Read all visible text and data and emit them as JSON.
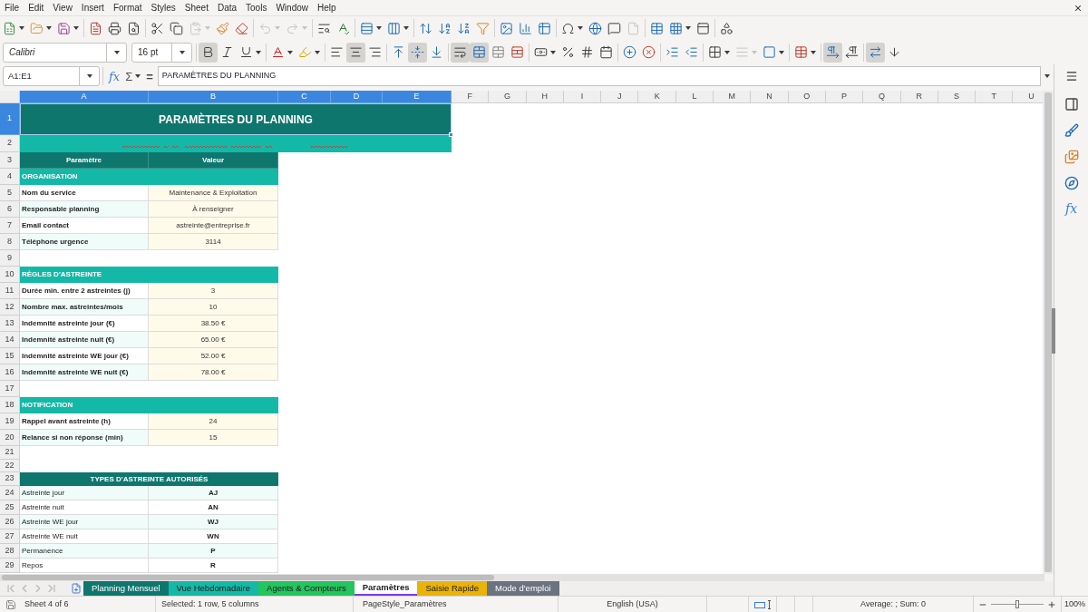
{
  "menu_bar": {
    "items": [
      "File",
      "Edit",
      "View",
      "Insert",
      "Format",
      "Styles",
      "Sheet",
      "Data",
      "Tools",
      "Window",
      "Help"
    ]
  },
  "standard_toolbar": [
    [
      {
        "kind": "new",
        "disabled": false
      },
      {
        "kind": "open",
        "disabled": false
      },
      {
        "kind": "save",
        "disabled": false
      }
    ],
    [
      {
        "kind": "export_pdf",
        "disabled": false
      },
      {
        "kind": "print",
        "disabled": false
      },
      {
        "kind": "print_preview",
        "disabled": false
      }
    ],
    [
      {
        "kind": "cut",
        "disabled": false
      },
      {
        "kind": "copy",
        "disabled": false
      },
      {
        "kind": "paste",
        "disabled": true
      },
      {
        "kind": "clone_formatting",
        "disabled": false
      },
      {
        "kind": "clear_formatting",
        "disabled": false
      }
    ],
    [
      {
        "kind": "undo",
        "disabled": true
      },
      {
        "kind": "redo",
        "disabled": true
      }
    ],
    [
      {
        "kind": "find_replace",
        "disabled": false
      },
      {
        "kind": "spelling",
        "disabled": false
      }
    ],
    [
      {
        "kind": "rows",
        "disabled": false
      },
      {
        "kind": "columns",
        "disabled": false
      }
    ],
    [
      {
        "kind": "sort",
        "disabled": false
      },
      {
        "kind": "sort_ascending",
        "disabled": false
      },
      {
        "kind": "sort_descending",
        "disabled": false
      },
      {
        "kind": "autofilter",
        "disabled": false
      }
    ],
    [
      {
        "kind": "image",
        "disabled": false
      },
      {
        "kind": "chart",
        "disabled": false
      },
      {
        "kind": "pivot_table",
        "disabled": false
      }
    ],
    [
      {
        "kind": "special_character",
        "disabled": false
      },
      {
        "kind": "hyperlink",
        "disabled": false
      },
      {
        "kind": "comment",
        "disabled": false
      },
      {
        "kind": "headers_footers",
        "disabled": true
      }
    ],
    [
      {
        "kind": "print_area",
        "disabled": false
      },
      {
        "kind": "freeze",
        "disabled": false
      },
      {
        "kind": "split_window",
        "disabled": false
      }
    ],
    [
      {
        "kind": "draw_functions",
        "disabled": false
      }
    ]
  ],
  "formatting_toolbar": {
    "font_name": "Calibri",
    "font_size": "16 pt",
    "groups": [
      [
        {
          "kind": "bold",
          "disabled": false,
          "on": true
        },
        {
          "kind": "italic",
          "disabled": false,
          "on": false
        },
        {
          "kind": "underline",
          "disabled": false,
          "on": false
        }
      ],
      [
        {
          "kind": "font_color",
          "disabled": false,
          "on": false
        },
        {
          "kind": "highlight",
          "disabled": false,
          "on": false
        }
      ],
      [
        {
          "kind": "align_left",
          "disabled": false,
          "on": false
        },
        {
          "kind": "align_center",
          "disabled": false,
          "on": true
        },
        {
          "kind": "align_right",
          "disabled": false,
          "on": false
        }
      ],
      [
        {
          "kind": "align_top",
          "disabled": false,
          "on": false
        },
        {
          "kind": "align_middle",
          "disabled": false,
          "on": true
        },
        {
          "kind": "align_bottom",
          "disabled": false,
          "on": false
        }
      ],
      [
        {
          "kind": "wrap_text",
          "disabled": false,
          "on": true
        },
        {
          "kind": "merge_center",
          "disabled": false,
          "on": true
        },
        {
          "kind": "merge",
          "disabled": false,
          "on": false
        },
        {
          "kind": "unmerge",
          "disabled": false,
          "on": false
        }
      ],
      [
        {
          "kind": "currency",
          "disabled": false,
          "on": false
        },
        {
          "kind": "percent",
          "disabled": false,
          "on": false
        },
        {
          "kind": "number",
          "disabled": false,
          "on": false
        },
        {
          "kind": "date",
          "disabled": false,
          "on": false
        }
      ],
      [
        {
          "kind": "add_decimal",
          "disabled": false,
          "on": false
        },
        {
          "kind": "delete_decimal",
          "disabled": false,
          "on": false
        }
      ],
      [
        {
          "kind": "indent_increase",
          "disabled": false,
          "on": false
        },
        {
          "kind": "indent_decrease",
          "disabled": false,
          "on": false
        }
      ],
      [
        {
          "kind": "borders",
          "disabled": false,
          "on": false
        },
        {
          "kind": "border_style",
          "disabled": true,
          "on": false
        },
        {
          "kind": "border_color",
          "disabled": false,
          "on": false
        }
      ],
      [
        {
          "kind": "conditional",
          "disabled": false,
          "on": false
        }
      ],
      [
        {
          "kind": "left_to_right",
          "disabled": false,
          "on": true
        },
        {
          "kind": "right_to_left",
          "disabled": false,
          "on": false
        }
      ],
      [
        {
          "kind": "text_horizontal",
          "disabled": false,
          "on": true
        },
        {
          "kind": "text_vertical",
          "disabled": false,
          "on": false
        }
      ]
    ]
  },
  "formula_bar": {
    "name_box": "A1:E1",
    "wizard_symbol": "fx",
    "sum_symbol": "Σ",
    "equals_symbol": "=",
    "content": "PARAMÈTRES DU PLANNING"
  },
  "sidebar": {
    "functions_symbol": "fx"
  },
  "sheet": {
    "columns": [
      {
        "label": "A",
        "selected": true
      },
      {
        "label": "B",
        "selected": true
      },
      {
        "label": "C",
        "selected": true
      },
      {
        "label": "D",
        "selected": true
      },
      {
        "label": "E",
        "selected": true
      },
      {
        "label": "F",
        "selected": false
      },
      {
        "label": "G",
        "selected": false
      },
      {
        "label": "H",
        "selected": false
      },
      {
        "label": "I",
        "selected": false
      },
      {
        "label": "J",
        "selected": false
      },
      {
        "label": "K",
        "selected": false
      },
      {
        "label": "L",
        "selected": false
      },
      {
        "label": "M",
        "selected": false
      },
      {
        "label": "N",
        "selected": false
      },
      {
        "label": "O",
        "selected": false
      },
      {
        "label": "P",
        "selected": false
      },
      {
        "label": "Q",
        "selected": false
      },
      {
        "label": "R",
        "selected": false
      },
      {
        "label": "S",
        "selected": false
      },
      {
        "label": "T",
        "selected": false
      },
      {
        "label": "U",
        "selected": false
      }
    ],
    "rows": [
      {
        "number": "1",
        "selected": true,
        "kind": "title",
        "cells": [
          "PARAMÈTRES DU PLANNING"
        ]
      },
      {
        "number": "2",
        "selected": false,
        "kind": "subtitle"
      },
      {
        "number": "3",
        "selected": false,
        "kind": "table_header",
        "cells": [
          "Paramètre",
          "Valeur"
        ]
      },
      {
        "number": "4",
        "selected": false,
        "kind": "section",
        "cells": [
          "ORGANISATION"
        ]
      },
      {
        "number": "5",
        "selected": false,
        "kind": "param",
        "shaded": false,
        "cells": [
          "Nom du service",
          "Maintenance & Exploitation"
        ]
      },
      {
        "number": "6",
        "selected": false,
        "kind": "param",
        "shaded": true,
        "cells": [
          "Responsable planning",
          "À renseigner"
        ]
      },
      {
        "number": "7",
        "selected": false,
        "kind": "param",
        "shaded": false,
        "cells": [
          "Email contact",
          "astreinte@entreprise.fr"
        ]
      },
      {
        "number": "8",
        "selected": false,
        "kind": "param",
        "shaded": true,
        "cells": [
          "Téléphone urgence",
          "3114"
        ]
      },
      {
        "number": "9",
        "selected": false,
        "kind": "empty"
      },
      {
        "number": "10",
        "selected": false,
        "kind": "section",
        "cells": [
          "RÈGLES D'ASTREINTE"
        ]
      },
      {
        "number": "11",
        "selected": false,
        "kind": "param",
        "shaded": false,
        "cells": [
          "Durée min. entre 2 astreintes (j)",
          "3"
        ]
      },
      {
        "number": "12",
        "selected": false,
        "kind": "param",
        "shaded": true,
        "cells": [
          "Nombre max. astreintes/mois",
          "10"
        ]
      },
      {
        "number": "13",
        "selected": false,
        "kind": "param",
        "shaded": false,
        "cells": [
          "Indemnité astreinte jour (€)",
          "38.50 €"
        ]
      },
      {
        "number": "14",
        "selected": false,
        "kind": "param",
        "shaded": true,
        "cells": [
          "Indemnité astreinte nuit (€)",
          "65.00 €"
        ]
      },
      {
        "number": "15",
        "selected": false,
        "kind": "param",
        "shaded": false,
        "cells": [
          "Indemnité astreinte WE jour (€)",
          "52.00 €"
        ]
      },
      {
        "number": "16",
        "selected": false,
        "kind": "param",
        "shaded": true,
        "cells": [
          "Indemnité astreinte WE nuit (€)",
          "78.00 €"
        ]
      },
      {
        "number": "17",
        "selected": false,
        "kind": "empty"
      },
      {
        "number": "18",
        "selected": false,
        "kind": "section",
        "cells": [
          "NOTIFICATION"
        ]
      },
      {
        "number": "19",
        "selected": false,
        "kind": "param",
        "shaded": false,
        "cells": [
          "Rappel avant astreinte (h)",
          "24"
        ]
      },
      {
        "number": "20",
        "selected": false,
        "kind": "param",
        "shaded": true,
        "cells": [
          "Relance si non réponse (min)",
          "15"
        ]
      },
      {
        "number": "21",
        "selected": false,
        "kind": "empty"
      },
      {
        "number": "22",
        "selected": false,
        "kind": "empty"
      },
      {
        "number": "23",
        "selected": false,
        "kind": "table_title",
        "cells": [
          "TYPES D'ASTREINTE AUTORISÉS"
        ]
      },
      {
        "number": "24",
        "selected": false,
        "kind": "type",
        "shaded": true,
        "cells": [
          "Astreinte jour",
          "AJ"
        ]
      },
      {
        "number": "25",
        "selected": false,
        "kind": "type",
        "shaded": false,
        "cells": [
          "Astreinte nuit",
          "AN"
        ]
      },
      {
        "number": "26",
        "selected": false,
        "kind": "type",
        "shaded": true,
        "cells": [
          "Astreinte WE jour",
          "WJ"
        ]
      },
      {
        "number": "27",
        "selected": false,
        "kind": "type",
        "shaded": false,
        "cells": [
          "Astreinte WE nuit",
          "WN"
        ]
      },
      {
        "number": "28",
        "selected": false,
        "kind": "type",
        "shaded": true,
        "cells": [
          "Permanence",
          "P"
        ]
      },
      {
        "number": "29",
        "selected": false,
        "kind": "type",
        "shaded": false,
        "cells": [
          "Repos",
          "R"
        ]
      }
    ]
  },
  "sheet_tabs": [
    {
      "label": "Planning Mensuel",
      "color": "#0f766e",
      "selected": false
    },
    {
      "label": "Vue Hebdomadaire",
      "color": "#14b8a6",
      "selected": false
    },
    {
      "label": "Agents & Compteurs",
      "color": "#22c55e",
      "selected": false
    },
    {
      "label": "Paramètres",
      "color": "#7c3aed",
      "selected": true
    },
    {
      "label": "Saisie Rapide",
      "color": "#eab308",
      "selected": false
    },
    {
      "label": "Mode d'emploi",
      "color": "#6b7280",
      "selected": false
    }
  ],
  "status_bar": {
    "sheet": "Sheet 4 of 6",
    "selection": "Selected: 1 row, 5 columns",
    "page_style": "PageStyle_Paramètres",
    "language": "English (USA)",
    "statistics": "Average: ; Sum: 0",
    "zoom": {
      "level": 0.5,
      "reading": "100%"
    }
  }
}
